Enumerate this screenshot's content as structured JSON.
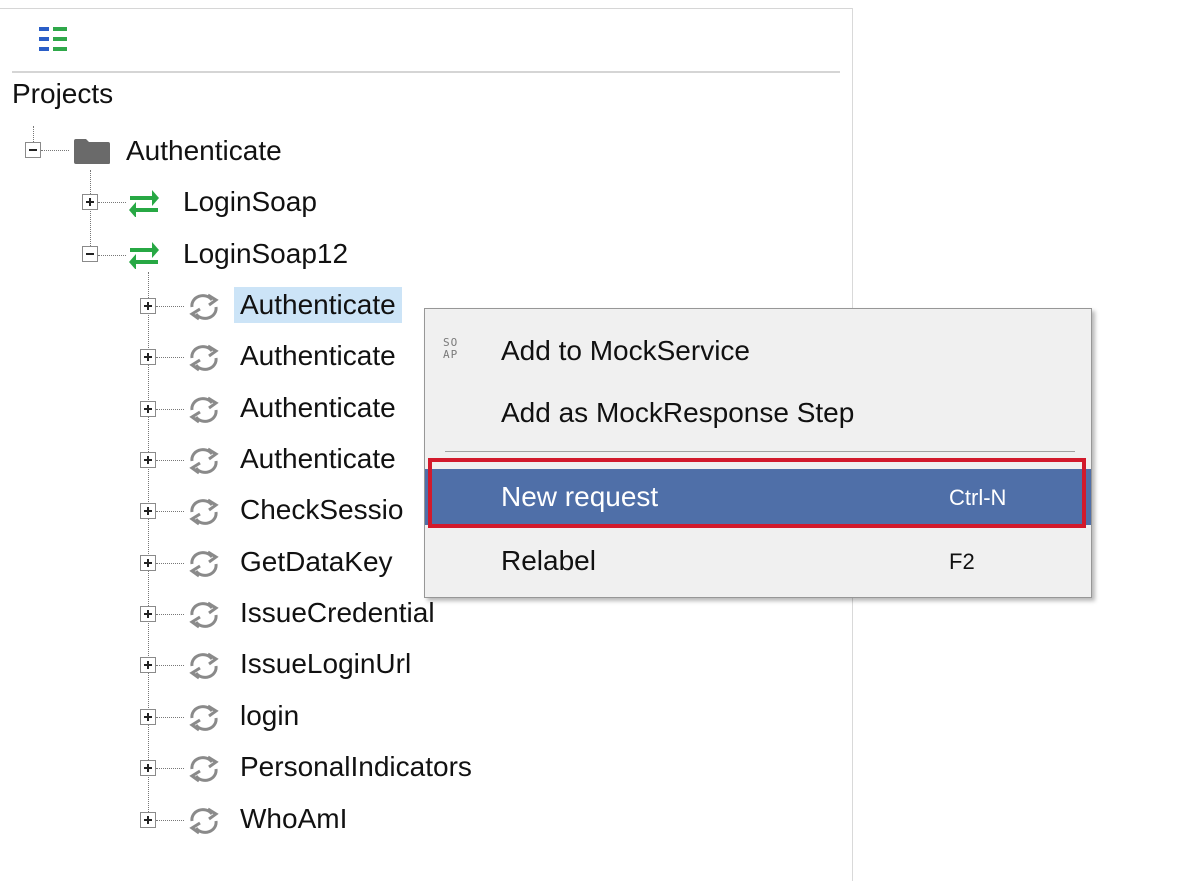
{
  "tree": {
    "header_label": "Projects",
    "project": {
      "label": "Authenticate",
      "icon": "folder-icon"
    },
    "interfaces": [
      {
        "label": "LoginSoap",
        "icon": "interface-arrows-icon",
        "expanded": false
      },
      {
        "label": "LoginSoap12",
        "icon": "interface-arrows-icon",
        "expanded": true
      }
    ],
    "operations": [
      {
        "label": "Authenticate",
        "selected": true
      },
      {
        "label": "Authenticate"
      },
      {
        "label": "Authenticate"
      },
      {
        "label": "Authenticate"
      },
      {
        "label": "CheckSessio"
      },
      {
        "label": "GetDataKey"
      },
      {
        "label": "IssueCredential"
      },
      {
        "label": "IssueLoginUrl"
      },
      {
        "label": "login"
      },
      {
        "label": "PersonalIndicators"
      },
      {
        "label": "WhoAmI"
      }
    ]
  },
  "context_menu": {
    "items": [
      {
        "label": "Add to MockService",
        "icon": "soap-icon",
        "shortcut": ""
      },
      {
        "label": "Add as MockResponse Step",
        "shortcut": ""
      },
      {
        "label": "New request",
        "shortcut": "Ctrl-N",
        "highlighted": true
      },
      {
        "label": "Relabel",
        "shortcut": "F2"
      }
    ],
    "soap_icon_text": [
      "SO",
      "AP"
    ]
  },
  "colors": {
    "interface_icon": "#27a844",
    "toolbar_icon_blue": "#2a5ec7",
    "toolbar_icon_green": "#2fa84a",
    "selection_bg": "#cce4f7",
    "menu_highlight": "#4f6fa8",
    "annotation_red": "#d21a2c"
  }
}
